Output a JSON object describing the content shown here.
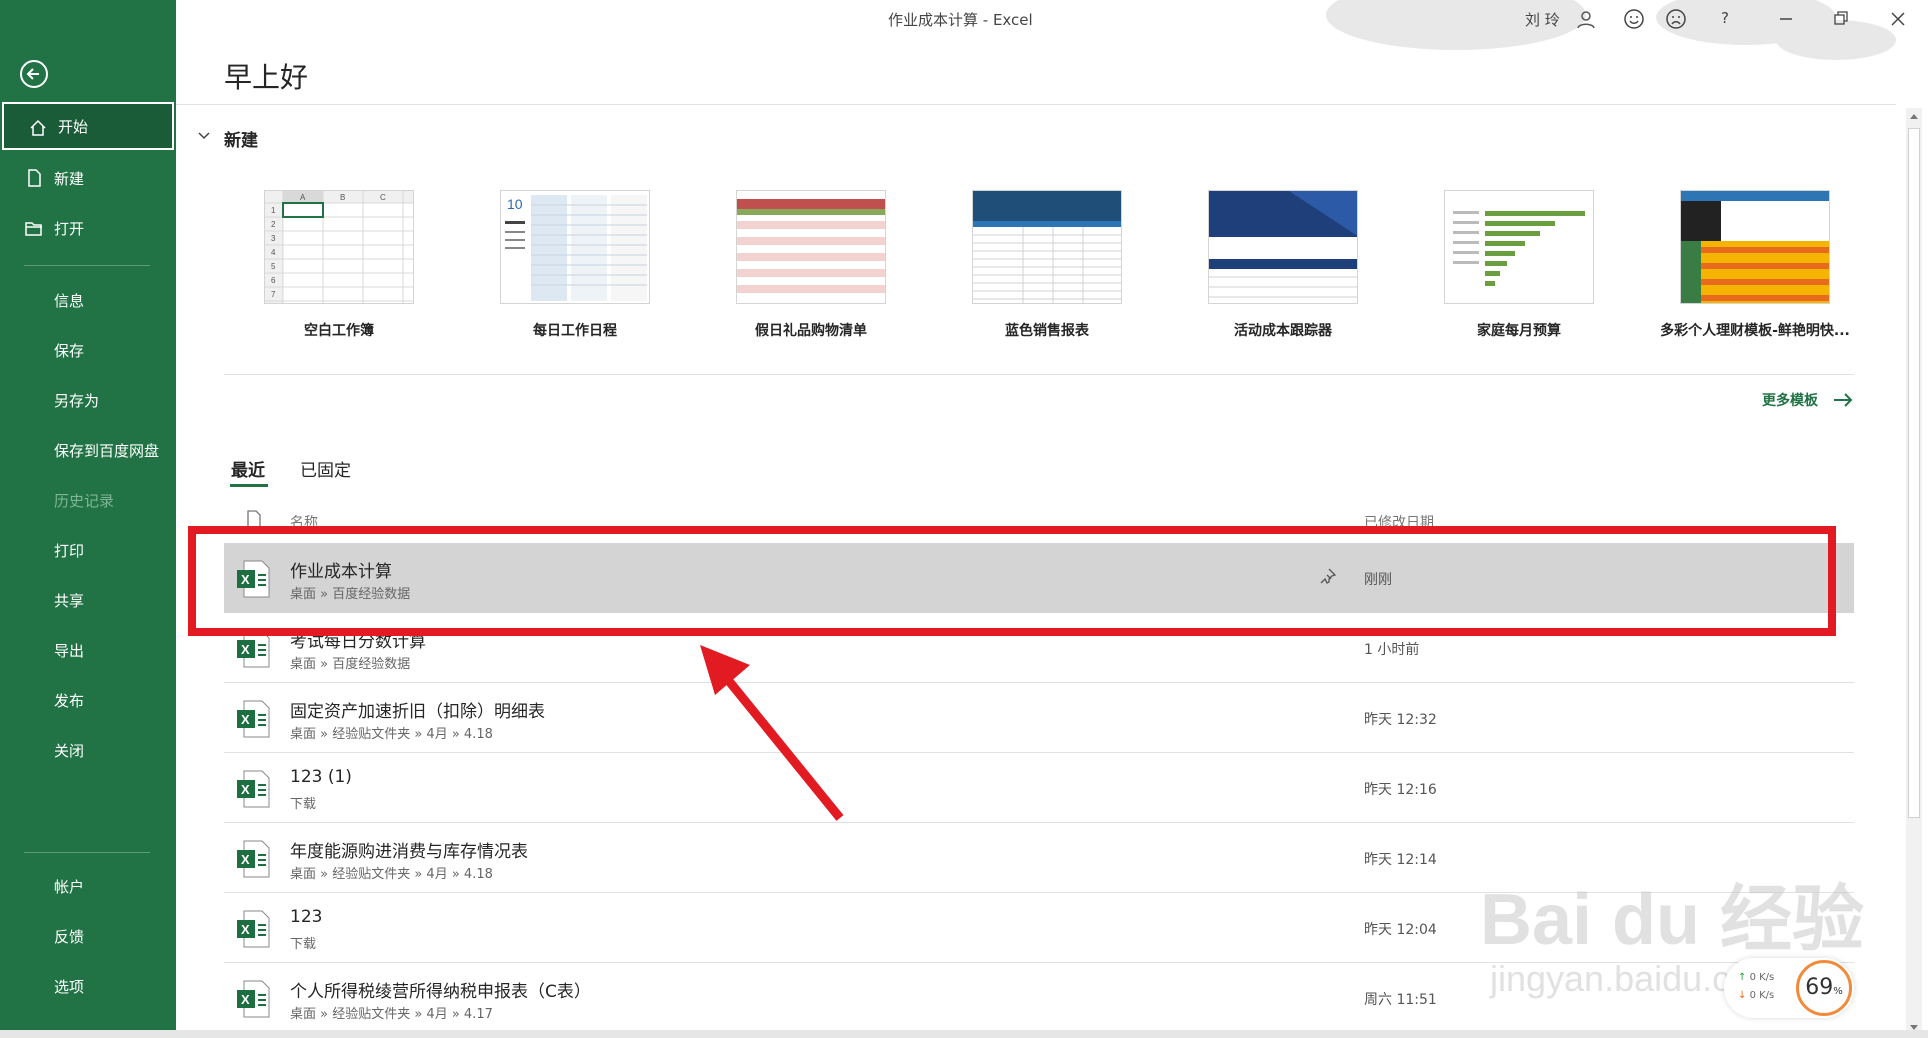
{
  "window": {
    "title": "作业成本计算  -  Excel",
    "user": "刘 玲"
  },
  "sidebar": {
    "items": [
      {
        "label": "开始"
      },
      {
        "label": "新建"
      },
      {
        "label": "打开"
      },
      {
        "label": "信息"
      },
      {
        "label": "保存"
      },
      {
        "label": "另存为"
      },
      {
        "label": "保存到百度网盘"
      },
      {
        "label": "历史记录"
      },
      {
        "label": "打印"
      },
      {
        "label": "共享"
      },
      {
        "label": "导出"
      },
      {
        "label": "发布"
      },
      {
        "label": "关闭"
      },
      {
        "label": "帐户"
      },
      {
        "label": "反馈"
      },
      {
        "label": "选项"
      }
    ]
  },
  "main": {
    "greeting": "早上好",
    "new_section": "新建",
    "templates": [
      {
        "label": "空白工作簿"
      },
      {
        "label": "每日工作日程"
      },
      {
        "label": "假日礼品购物清单"
      },
      {
        "label": "蓝色销售报表"
      },
      {
        "label": "活动成本跟踪器"
      },
      {
        "label": "家庭每月预算"
      },
      {
        "label": "多彩个人理财模板-鲜艳明快..."
      }
    ],
    "more_templates": "更多模板",
    "tabs": [
      {
        "label": "最近"
      },
      {
        "label": "已固定"
      }
    ],
    "columns": {
      "name": "名称",
      "modified": "已修改日期"
    },
    "files": [
      {
        "name": "作业成本计算",
        "path": "桌面 » 百度经验数据",
        "date": "刚刚"
      },
      {
        "name": "考试每日分数计算",
        "path": "桌面 » 百度经验数据",
        "date": "1 小时前"
      },
      {
        "name": "固定资产加速折旧（扣除）明细表",
        "path": "桌面 » 经验贴文件夹 » 4月 » 4.18",
        "date": "昨天 12:32"
      },
      {
        "name": "123 (1)",
        "path": "下载",
        "date": "昨天 12:16"
      },
      {
        "name": "年度能源购进消费与库存情况表",
        "path": "桌面 » 经验贴文件夹 » 4月 » 4.18",
        "date": "昨天 12:14"
      },
      {
        "name": "123",
        "path": "下载",
        "date": "昨天 12:04"
      },
      {
        "name": "个人所得税绫营所得纳税申报表（C表）",
        "path": "桌面 » 经验贴文件夹 » 4月 » 4.17",
        "date": "周六 11:51"
      }
    ]
  },
  "watermark": {
    "text": "Bai du 经验",
    "url": "jingyan.baidu.com"
  },
  "speed_widget": {
    "up": "0  K/s",
    "down": "0  K/s",
    "percent": "69",
    "unit": "%"
  },
  "colors": {
    "brand": "#217346",
    "highlight": "#e21a22",
    "selected_row": "#d4d4d4"
  }
}
